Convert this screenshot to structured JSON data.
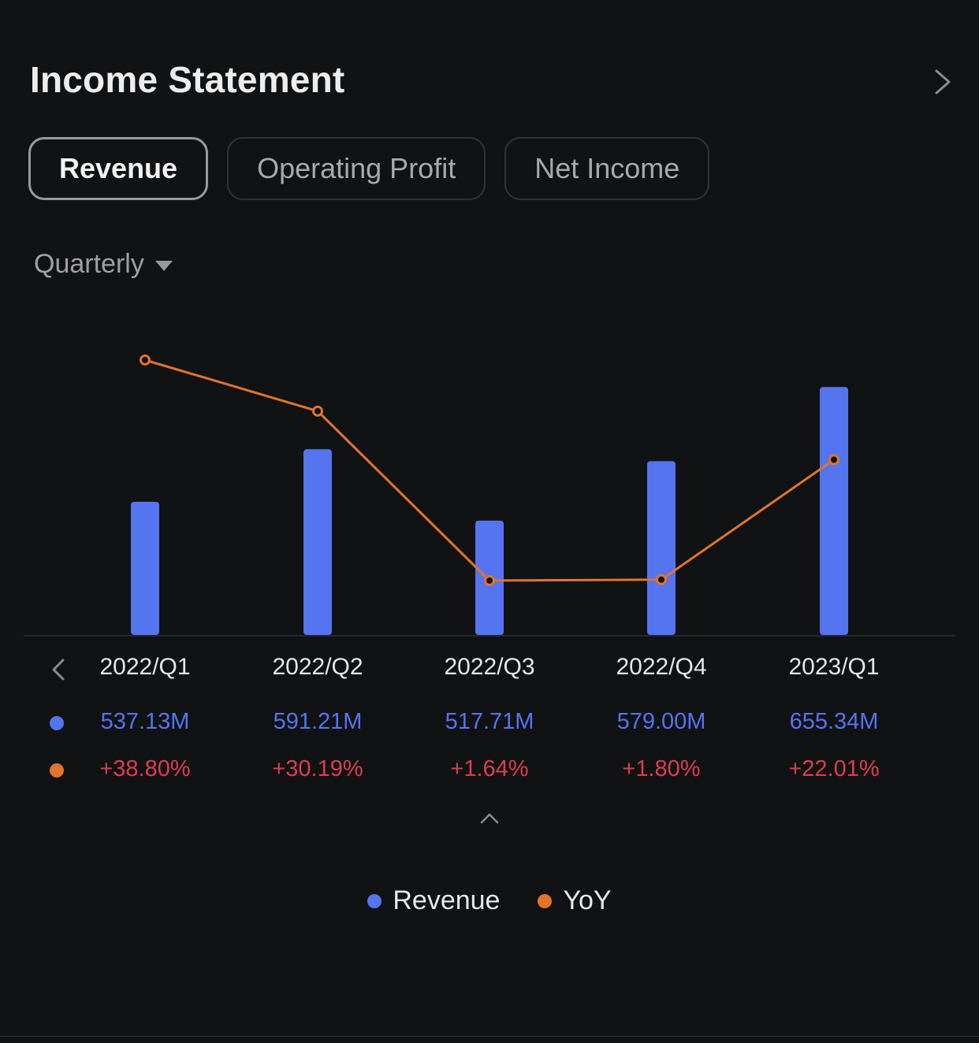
{
  "header": {
    "title": "Income Statement",
    "more_icon": "chevron-right-icon"
  },
  "tabs": [
    {
      "label": "Revenue",
      "active": true
    },
    {
      "label": "Operating Profit",
      "active": false
    },
    {
      "label": "Net Income",
      "active": false
    }
  ],
  "period_select": {
    "value": "Quarterly",
    "icon": "caret-down-icon"
  },
  "colors": {
    "revenue": "#5574ef",
    "yoy": "#e0742f",
    "yoy_text": "#dc3d4e",
    "background": "#111214"
  },
  "table": {
    "prev_icon": "chevron-left-icon",
    "collapse_icon": "chevron-up-icon",
    "periods": [
      "2022/Q1",
      "2022/Q2",
      "2022/Q3",
      "2022/Q4",
      "2023/Q1"
    ],
    "revenue_labels": [
      "537.13M",
      "591.21M",
      "517.71M",
      "579.00M",
      "655.34M"
    ],
    "yoy_labels": [
      "+38.80%",
      "+30.19%",
      "+1.64%",
      "+1.80%",
      "+22.01%"
    ]
  },
  "legend": [
    {
      "label": "Revenue"
    },
    {
      "label": "YoY"
    }
  ],
  "chart_data": {
    "type": "bar",
    "title": "Income Statement - Revenue (Quarterly)",
    "categories": [
      "2022/Q1",
      "2022/Q2",
      "2022/Q3",
      "2022/Q4",
      "2023/Q1"
    ],
    "series": [
      {
        "name": "Revenue",
        "type": "bar",
        "unit": "M",
        "values": [
          537.13,
          591.21,
          517.71,
          579.0,
          655.34
        ]
      },
      {
        "name": "YoY",
        "type": "line",
        "unit": "%",
        "values": [
          38.8,
          30.19,
          1.64,
          1.8,
          22.01
        ]
      }
    ],
    "xlabel": "",
    "ylabel": "",
    "grid": false,
    "legend_position": "bottom-center"
  }
}
